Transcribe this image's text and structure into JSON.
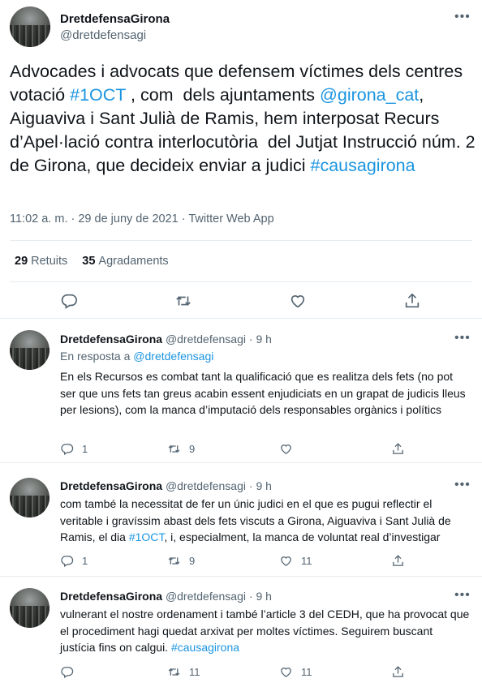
{
  "main_tweet": {
    "display_name": "DretdefensaGirona",
    "handle": "@dretdefensagi",
    "text_parts": [
      {
        "t": "Advocades i advocats que defensem víctimes dels centres votació ",
        "link": false
      },
      {
        "t": "#1OCT",
        "link": true
      },
      {
        "t": " , com  dels ajuntaments ",
        "link": false
      },
      {
        "t": "@girona_cat",
        "link": true
      },
      {
        "t": ", Aiguaviva i Sant Julià de Ramis, hem interposat Recurs d’Apel·lació contra interlocutòria  del Jutjat Instrucció núm. 2 de Girona, que decideix enviar a judici ",
        "link": false
      },
      {
        "t": "#causagirona",
        "link": true
      }
    ],
    "meta": "11:02 a. m. · 29 de juny de 2021 · Twitter Web App",
    "retweets_count": "29",
    "retweets_label": "Retuits",
    "likes_count": "35",
    "likes_label": "Agradaments"
  },
  "replies": [
    {
      "display_name": "DretdefensaGirona",
      "handle": "@dretdefensagi",
      "time": "· 9 h",
      "in_reply_prefix": "En resposta a ",
      "in_reply_handle": "@dretdefensagi",
      "text_parts": [
        {
          "t": "En els Recursos es combat tant la qualificació que es realitza dels fets (no pot ser que uns fets tan greus acabin essent enjudiciats en un grapat de judicis lleus per lesions), com la manca d’imputació dels responsables orgànics i polítics",
          "link": false
        }
      ],
      "replies": "1",
      "retweets": "9",
      "likes": ""
    },
    {
      "display_name": "DretdefensaGirona",
      "handle": "@dretdefensagi",
      "time": "· 9 h",
      "text_parts": [
        {
          "t": "com també la necessitat de fer un únic judici en el que es pugui reflectir el veritable i gravíssim abast dels fets viscuts a Girona, Aiguaviva i Sant Julià de Ramis, el dia ",
          "link": false
        },
        {
          "t": "#1OCT",
          "link": true
        },
        {
          "t": ", i, especialment, la manca de voluntat real d’investigar",
          "link": false
        }
      ],
      "replies": "1",
      "retweets": "9",
      "likes": "11"
    },
    {
      "display_name": "DretdefensaGirona",
      "handle": "@dretdefensagi",
      "time": "· 9 h",
      "text_parts": [
        {
          "t": "vulnerant el nostre ordenament i també l’article 3 del CEDH, que ha provocat que el procediment hagi quedat arxivat per moltes víctimes. Seguirem buscant justícia fins on calgui. ",
          "link": false
        },
        {
          "t": "#causagirona",
          "link": true
        }
      ],
      "replies": "",
      "retweets": "11",
      "likes": "11"
    }
  ],
  "colors": {
    "accent": "#1b95e0",
    "text": "#0f1419",
    "muted": "#536471",
    "divider": "#e6ecf0"
  }
}
